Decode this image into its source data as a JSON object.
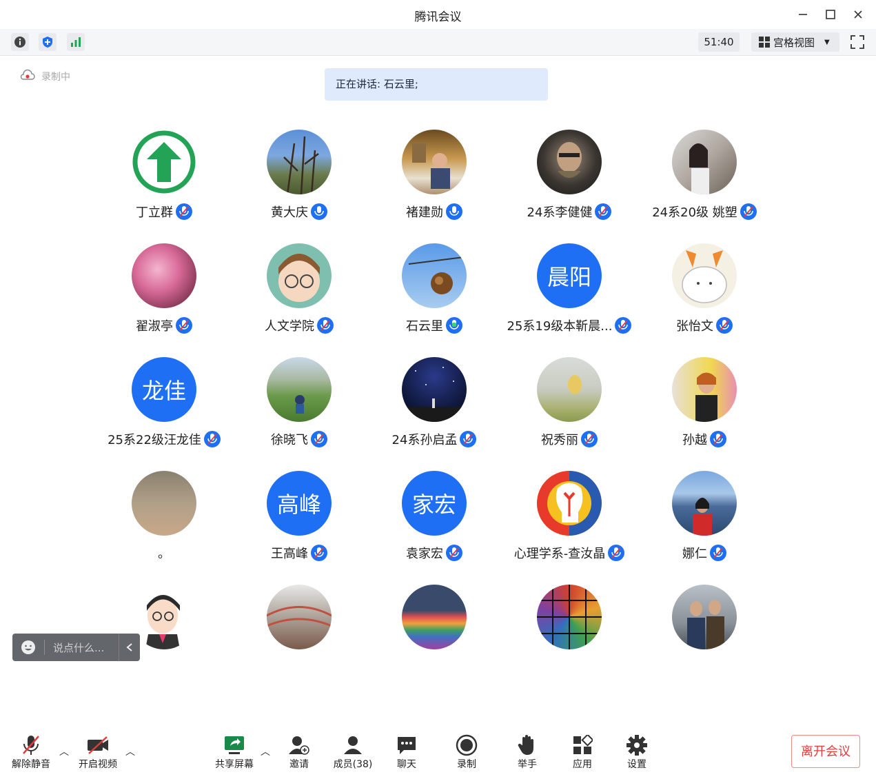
{
  "window": {
    "title": "腾讯会议"
  },
  "toolbar": {
    "timer": "51:40",
    "view_label": "宫格视图",
    "icons": [
      "info-icon",
      "security-shield-icon",
      "signal-bars-icon"
    ]
  },
  "recording": {
    "label": "录制中"
  },
  "speaking": {
    "text": "正在讲话: 石云里;"
  },
  "participants": [
    {
      "name": "丁立群",
      "avatar": "green-arrow"
    },
    {
      "name": "黄大庆",
      "avatar": "photo-branches"
    },
    {
      "name": "褚建勋",
      "avatar": "photo-office"
    },
    {
      "name": "24系李健健",
      "avatar": "photo-portrait"
    },
    {
      "name": "24系20级 姚塑",
      "avatar": "photo-room"
    },
    {
      "name": "翟淑亭",
      "avatar": "photo-flowers"
    },
    {
      "name": "人文学院",
      "avatar": "cartoon-girl"
    },
    {
      "name": "石云里",
      "avatar": "photo-fruit"
    },
    {
      "name": "25系19级本靳晨...",
      "avatar": "text",
      "initials": "晨阳"
    },
    {
      "name": "张怡文",
      "avatar": "cartoon-bunny"
    },
    {
      "name": "25系22级汪龙佳",
      "avatar": "text",
      "initials": "龙佳"
    },
    {
      "name": "徐晓飞",
      "avatar": "photo-hill"
    },
    {
      "name": "24系孙启孟",
      "avatar": "photo-nightsky"
    },
    {
      "name": "祝秀丽",
      "avatar": "painting-field"
    },
    {
      "name": "孙越",
      "avatar": "photo-woman"
    },
    {
      "name": "。",
      "avatar": "photo-clouds"
    },
    {
      "name": "王高峰",
      "avatar": "text",
      "initials": "高峰"
    },
    {
      "name": "袁家宏",
      "avatar": "text",
      "initials": "家宏"
    },
    {
      "name": "心理学系-查汝晶",
      "avatar": "psych-logo"
    },
    {
      "name": "娜仁",
      "avatar": "photo-lake"
    },
    {
      "name": "",
      "avatar": "cartoon-man"
    },
    {
      "name": "",
      "avatar": "photo-building"
    },
    {
      "name": "",
      "avatar": "photo-rainbow"
    },
    {
      "name": "",
      "avatar": "photo-mosaic"
    },
    {
      "name": "",
      "avatar": "photo-two-men"
    }
  ],
  "chat": {
    "placeholder": "说点什么..."
  },
  "bottom": {
    "unmute": "解除静音",
    "video": "开启视频",
    "share": "共享屏幕",
    "invite": "邀请",
    "members": "成员(38)",
    "chat": "聊天",
    "record": "录制",
    "raise_hand": "举手",
    "apps": "应用",
    "settings": "设置",
    "leave": "离开会议"
  },
  "colors": {
    "accent": "#1f6ff5",
    "danger": "#e43b3b",
    "green": "#22a355"
  }
}
